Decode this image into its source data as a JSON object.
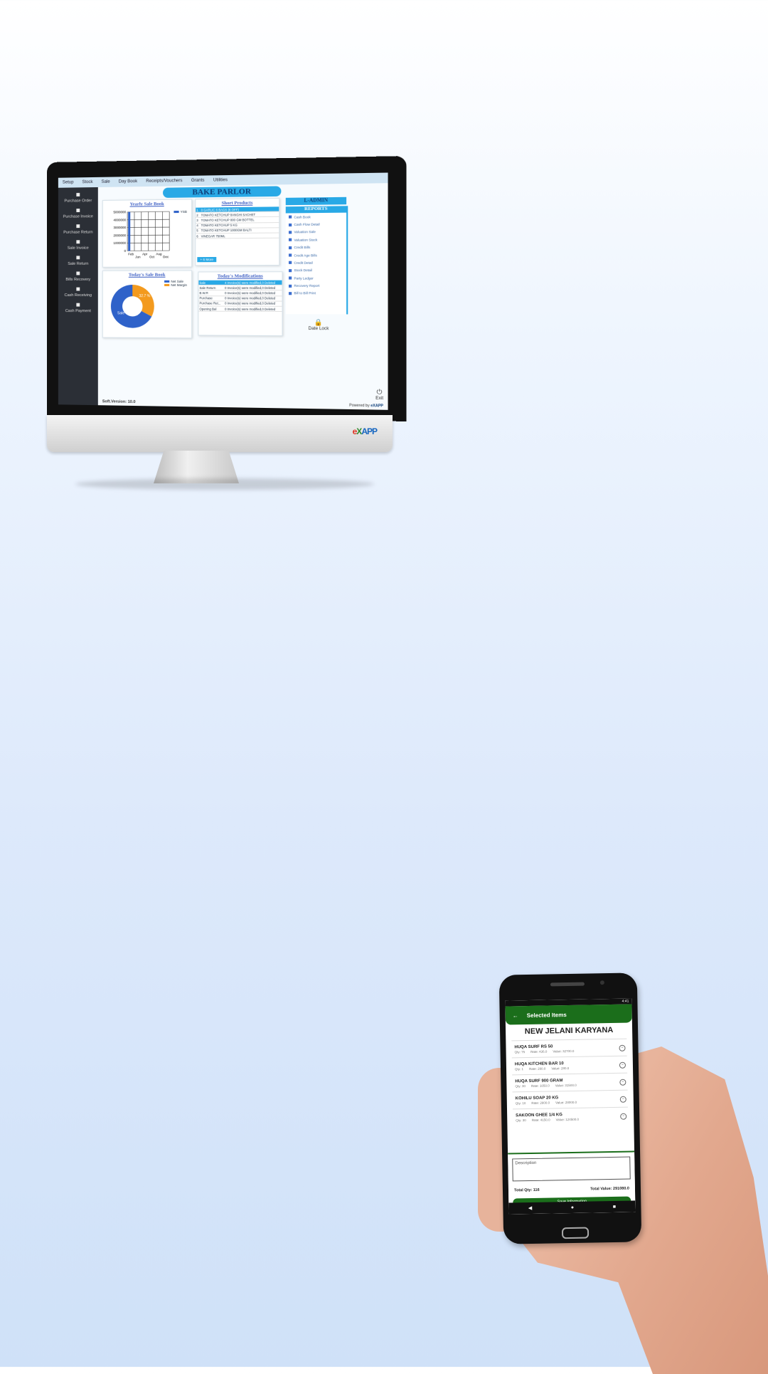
{
  "desktop": {
    "menu": [
      "Setup",
      "Stock",
      "Sale",
      "Day Book",
      "Receipts/Vouchers",
      "Grants",
      "Utilities"
    ],
    "sidebar": [
      {
        "label": "Purchase Order",
        "icon": "basket-icon"
      },
      {
        "label": "Purchase Invoice",
        "icon": "cart-icon"
      },
      {
        "label": "Purchase Return",
        "icon": "return-arrow-icon"
      },
      {
        "label": "Sale Invoice",
        "icon": "document-icon"
      },
      {
        "label": "Sale Return",
        "icon": "document-icon"
      },
      {
        "label": "Bills Recovery",
        "icon": "cash-icon"
      },
      {
        "label": "Cash Receiving",
        "icon": "cash-icon"
      },
      {
        "label": "Cash Payment",
        "icon": "wallet-icon"
      }
    ],
    "title": "BAKE PARLOR",
    "yearly_title": "Yearly Sale Book",
    "yearly_legend": "YSB",
    "today_title": "Today's Sale Book",
    "today_legend": [
      "Net Sale",
      "Net Margin"
    ],
    "today_labels": {
      "sale": "Sale",
      "pct": "32.7 %"
    },
    "stock_title": "Short Products",
    "stock_rows": [
      [
        "1",
        "0 GARLIC 6 BAGS (6 OFF)"
      ],
      [
        "2",
        "TOMATO KETCHUP 8ANGHI SACHET"
      ],
      [
        "3",
        "TOMATO KETCHUP 800 GM BOTTEL"
      ],
      [
        "4",
        "TOMATO KETCHUP 5 KG"
      ],
      [
        "5",
        "TOMATO KETCHUP 1000GM BALTI"
      ],
      [
        "6",
        "VINEGAR 750ML"
      ]
    ],
    "more_label": "+ 6 More",
    "mods_title": "Today's Modifications",
    "mods_rows": [
      [
        "Sale",
        "4 Invoice(s) were modified,0 Deleted"
      ],
      [
        "Sale Return",
        "0 Invoice(s) were modified,0 Deleted"
      ],
      [
        "B.W.R",
        "0 Invoice(s) were modified,0 Deleted"
      ],
      [
        "Purchase",
        "0 Invoice(s) were modified,0 Deleted"
      ],
      [
        "Purchase Ret...",
        "0 Invoice(s) were modified,0 Deleted"
      ],
      [
        "Opening Bal",
        "0 Invoice(s) were modified,0 Deleted"
      ]
    ],
    "admin_label": "L-ADMIN",
    "reports_title": "REPORTS",
    "reports": [
      "Cash Book",
      "Cash Flow Detail",
      "Valuation Sale",
      "Valuation Stock",
      "Credit Bills",
      "Credit Age Bills",
      "Credit Detail",
      "Stock Detail",
      "Party Ledger",
      "Recovery Report",
      "Bill to Bill Print"
    ],
    "date_lock": "Date Lock",
    "exit": "Exit",
    "version": "Soft.Version: 10.0",
    "powered_label": "Powered by",
    "powered_brand": "eXAPP",
    "chin_logo": [
      "e",
      "X",
      "APP"
    ]
  },
  "chart_data": [
    {
      "type": "bar",
      "title": "Yearly Sale Book",
      "categories": [
        "Feb",
        "Jun",
        "Apr",
        "Oct",
        "Aug",
        "Dec"
      ],
      "series": [
        {
          "name": "YSB",
          "values": [
            5000000,
            0,
            0,
            0,
            0,
            0
          ]
        }
      ],
      "y_ticks": [
        "5000000",
        "4000000",
        "3000000",
        "2000000",
        "1000000",
        "0"
      ],
      "ylim": [
        0,
        5000000
      ],
      "grid": true,
      "legend": "top-right"
    },
    {
      "type": "pie",
      "title": "Today's Sale Book",
      "slices": [
        {
          "name": "Net Sale",
          "value": 67.3,
          "color": "#2f62c9"
        },
        {
          "name": "Net Margin",
          "value": 32.7,
          "color": "#f39a1e"
        }
      ],
      "legend": "top-right"
    }
  ],
  "phone": {
    "status_time": "4:41",
    "header_title": "Selected Items",
    "store": "NEW JELANI KARYANA",
    "items": [
      {
        "name": "HUQA SURF RS 50",
        "qty": "Qty: 75",
        "rate": "Rate: 436.0",
        "value": "Value: 32700.0"
      },
      {
        "name": "HUQA KITCHEN BAR 10",
        "qty": "Qty: 1",
        "rate": "Rate: 280.0",
        "value": "Value: 280.0"
      },
      {
        "name": "HUQA SURF 900 GRAM",
        "qty": "Qty: 30",
        "rate": "Rate: 1050.0",
        "value": "Value: 31500.0"
      },
      {
        "name": "KOHILU SOAP 20 KG",
        "qty": "Qty: 10",
        "rate": "Rate: 2800.0",
        "value": "Value: 28000.0"
      },
      {
        "name": "SAKOON GHEE 1/4 KG",
        "qty": "Qty: 30",
        "rate": "Rate: 4150.0",
        "value": "Value: 124500.0"
      }
    ],
    "description_placeholder": "Description",
    "total_qty": "Total Qty: 116",
    "total_value": "Total Value: 291080.0",
    "save_button": "Save Information",
    "accent": "#1b6e1b"
  }
}
